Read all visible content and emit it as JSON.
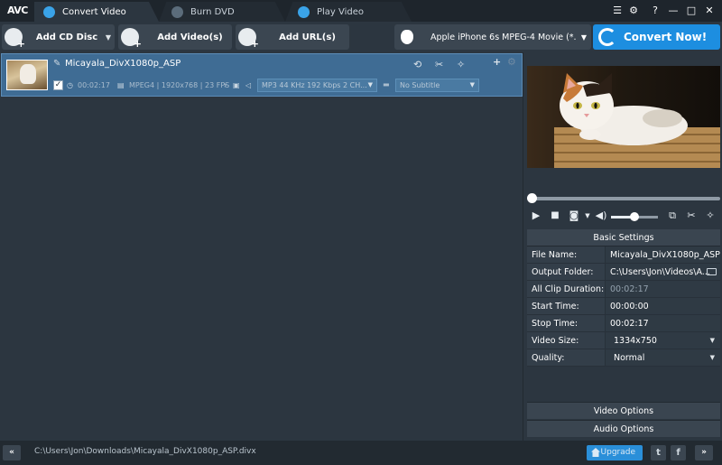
{
  "app": {
    "logo": "AVC",
    "tabs": [
      {
        "label": "Convert Video"
      },
      {
        "label": "Burn DVD"
      },
      {
        "label": "Play Video"
      }
    ],
    "window_controls": {
      "menu": "☰",
      "gear": "⚙",
      "help": "?",
      "minimize": "—",
      "maximize": "□",
      "close": "✕"
    }
  },
  "toolbar": {
    "add_cd_disc": "Add CD Disc",
    "add_videos": "Add Video(s)",
    "add_urls": "Add URL(s)",
    "profile": "Apple iPhone 6s MPEG-4 Movie (*.m...",
    "convert_now": "Convert Now!"
  },
  "file_list": {
    "items": [
      {
        "name": "Micayala_DivX1080p_ASP",
        "duration": "00:02:17",
        "video_info": "MPEG4 | 1920x768 | 23 FPS",
        "audio_track": "MP3 44 KHz 192 Kbps 2 CH...",
        "subtitle": "No Subtitle",
        "checked": true
      }
    ]
  },
  "player": {
    "progress_fraction": 0.0,
    "volume_fraction": 0.5
  },
  "basic_settings": {
    "header": "Basic Settings",
    "rows": [
      {
        "label": "File Name:",
        "value": "Micayala_DivX1080p_ASP"
      },
      {
        "label": "Output Folder:",
        "value": "C:\\Users\\Jon\\Videos\\A..."
      },
      {
        "label": "All Clip Duration:",
        "value": "00:02:17"
      },
      {
        "label": "Start Time:",
        "value": "00:00:00"
      },
      {
        "label": "Stop Time:",
        "value": "00:02:17"
      },
      {
        "label": "Video Size:",
        "value": "1334x750"
      },
      {
        "label": "Quality:",
        "value": "Normal"
      }
    ]
  },
  "sections": {
    "video_options": "Video Options",
    "audio_options": "Audio Options"
  },
  "status_bar": {
    "path": "C:\\Users\\Jon\\Downloads\\Micayala_DivX1080p_ASP.divx",
    "upgrade": "Upgrade",
    "nav_left": "«",
    "nav_right": "»"
  },
  "colors": {
    "accent": "#1d8ee0",
    "selected_row": "#3f6c94",
    "panel": "#2c3640"
  }
}
